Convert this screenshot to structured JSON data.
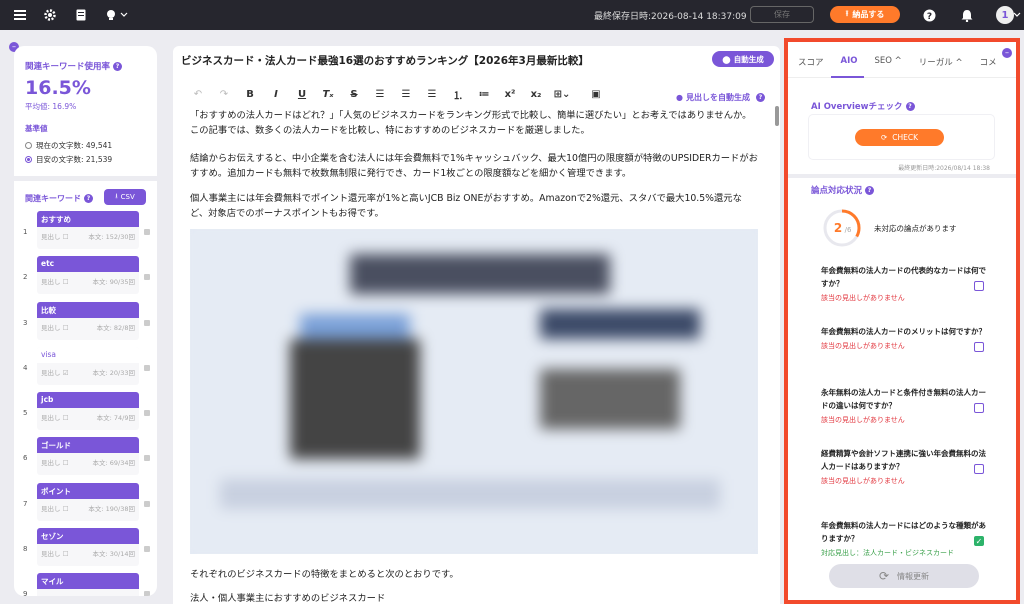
{
  "topbar": {
    "saved_label": "最終保存日時:2026-08-14 18:37:09",
    "disabled_label": "保存",
    "submit_label": "納品する",
    "avatar": "1"
  },
  "left_panel": {
    "title": "関連キーワード使用率",
    "rate": "16.5%",
    "avg": "平均値: 16.9%",
    "base_title": "基準値",
    "radio_current": "現在の文字数: 49,541",
    "radio_target": "目安の文字数: 21,539",
    "kw_title": "関連キーワード",
    "csv_label": "CSV",
    "keywords": [
      {
        "num": "1",
        "name": "おすすめ",
        "heading": "見出し ☐",
        "body": "本文: 152/30回"
      },
      {
        "num": "2",
        "name": "etc",
        "heading": "見出し ☐",
        "body": "本文: 90/35回"
      },
      {
        "num": "3",
        "name": "比較",
        "heading": "見出し ☐",
        "body": "本文: 82/8回"
      },
      {
        "num": "4",
        "name": "visa",
        "heading": "見出し ☑",
        "body": "本文: 20/33回"
      },
      {
        "num": "5",
        "name": "jcb",
        "heading": "見出し ☐",
        "body": "本文: 74/9回"
      },
      {
        "num": "6",
        "name": "ゴールド",
        "heading": "見出し ☐",
        "body": "本文: 69/34回"
      },
      {
        "num": "7",
        "name": "ポイント",
        "heading": "見出し ☐",
        "body": "本文: 190/38回"
      },
      {
        "num": "8",
        "name": "セゾン",
        "heading": "見出し ☐",
        "body": "本文: 30/14回"
      },
      {
        "num": "9",
        "name": "マイル",
        "heading": "",
        "body": ""
      }
    ]
  },
  "editor": {
    "title": "ビジネスカード・法人カード最強16選のおすすめランキング【2026年3月最新比較】",
    "auto_gen": "自動生成",
    "auto_heading": "見出しを自動生成",
    "paragraphs": [
      "「おすすめの法人カードはどれ？」「人気のビジネスカードをランキング形式で比較し、簡単に選びたい」とお考えではありませんか。この記事では、数多くの法人カードを比較し、特におすすめのビジネスカードを厳選しました。",
      "結論からお伝えすると、中小企業を含む法人には年会費無料で1%キャッシュバック、最大10億円の限度額が特徴のUPSIDERカードがおすすめ。追加カードも無料で枚数無制限に発行でき、カード1枚ごとの限度額などを細かく管理できます。",
      "個人事業主には年会費無料でポイント還元率が1%と高いJCB Biz ONEがおすすめ。Amazonで2%還元、スタバで最大10.5%還元など、対象店でのボーナスポイントもお得です。",
      "それぞれのビジネスカードの特徴をまとめると次のとおりです。",
      "法人・個人事業主におすすめのビジネスカード"
    ]
  },
  "right_panel": {
    "tabs": [
      "スコア",
      "AIO",
      "SEO ^",
      "リーガル ^",
      "コメ"
    ],
    "aio_title": "AI Overviewチェック",
    "check_label": "CHECK",
    "updated": "最終更新日時:2026/08/14 18:38",
    "topics_title": "論点対応状況",
    "progress_done": "2",
    "progress_total": "/6",
    "progress_value": 0.333,
    "unanswered": "未対応の論点があります",
    "questions": [
      {
        "q": "年会費無料の法人カードの代表的なカードは何ですか？",
        "status": "該当の見出しがありません",
        "checked": false
      },
      {
        "q": "年会費無料の法人カードのメリットは何ですか？",
        "status": "該当の見出しがありません",
        "checked": false
      },
      {
        "q": "永年無料の法人カードと条件付き無料の法人カードの違いは何ですか？",
        "status": "該当の見出しがありません",
        "checked": false
      },
      {
        "q": "経費精算や会計ソフト連携に強い年会費無料の法人カードはありますか？",
        "status": "該当の見出しがありません",
        "checked": false
      },
      {
        "q": "年会費無料の法人カードにはどのような種類がありますか？",
        "status": "対応見出し：法人カード・ビジネスカード",
        "checked": true
      }
    ],
    "refresh_label": "情報更新"
  },
  "colors": {
    "accent": "#7a56d8",
    "orange": "#ff7a2a",
    "highlight_border": "#f24a2c"
  }
}
